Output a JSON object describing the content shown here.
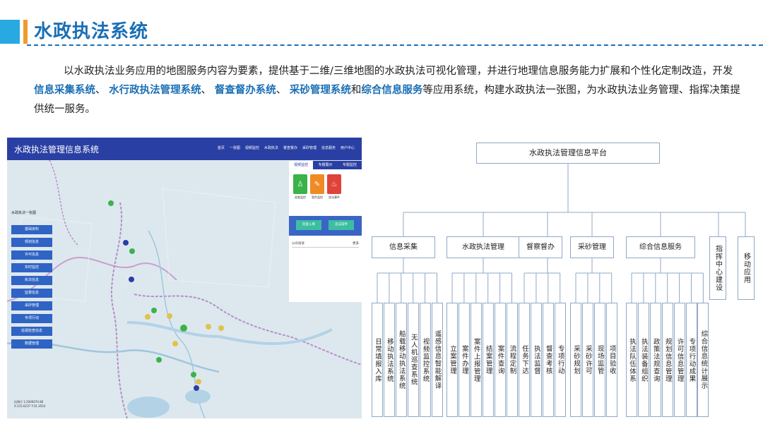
{
  "header": {
    "title": "水政执法系统",
    "accent_blue": "#29a9e1",
    "accent_orange": "#f29a2e",
    "title_color": "#1a6fb5"
  },
  "intro": {
    "p1": "以水政执法业务应用的地图服务内容为要素，提供基于二维/三维地图的水政执法可视化管理，并进行地理信息服务能力扩展和个性化定制改造，开发",
    "h1": "信息采集系统",
    "s1": "、 ",
    "h2": "水行政执法管理系统",
    "s2": "、 ",
    "h3": "督查督办系统",
    "s3": "、 ",
    "h4": "采砂管理系统",
    "s4": "和",
    "h5": "综合信息服务",
    "p2": "等应用系统，构建水政执法一张图，为水政执法业务管理、指挥决策提供统一服务。"
  },
  "screenshot": {
    "title": "水政执法管理信息系统",
    "nav": [
      "首页",
      "一张图",
      "视频监控",
      "水政执法",
      "督查督办",
      "采砂管理",
      "信息服务",
      "用户中心"
    ],
    "side_heading": "水政执法一张图",
    "side_items": [
      "基础资料",
      "规划信息",
      "许可信息",
      "实时监控",
      "执法信息",
      "监督信息",
      "采砂管理",
      "专项行动",
      "巡视检查信息",
      "数据管理"
    ],
    "panel_tabs": [
      "视频监控",
      "专题展示",
      "专题监控"
    ],
    "panel_icons": [
      {
        "label": "巡查监控",
        "icon": "patrol-icon",
        "color": "#3ab34a",
        "glyph": "♙"
      },
      {
        "label": "案件监控",
        "icon": "case-icon",
        "color": "#f08a24",
        "glyph": "✎"
      },
      {
        "label": "违法事件",
        "icon": "alarm-icon",
        "color": "#e0433a",
        "glyph": "♨"
      }
    ],
    "panel_buttons": [
      "巡查入库",
      "违法案件"
    ],
    "notice": "公众投诉",
    "notice_more": "更多",
    "coords_line1": "比例尺 1:2000074.86",
    "coords_line2": "X:115.6237 Y:31.3554"
  },
  "org_chart": {
    "root": "水政执法管理信息平台",
    "groups": [
      {
        "label": "信息采集",
        "children": [
          "日常填报入库",
          "移动执法系统",
          "船载移动执法系统",
          "无人机巡查系统",
          "视频监控系统",
          "遥感信息智能解译"
        ]
      },
      {
        "label": "水政执法管理",
        "children": [
          "立案管理",
          "案件办理",
          "案件上报管理",
          "结案管理",
          "案件查询",
          "流程定制"
        ]
      },
      {
        "label": "督察督办",
        "children": [
          "任务下达",
          "执法监督",
          "督查考核",
          "专项行动"
        ]
      },
      {
        "label": "采砂管理",
        "children": [
          "采砂规划",
          "采砂许可",
          "现场监管",
          "项目验收"
        ]
      },
      {
        "label": "综合信息服务",
        "children": [
          "执法队伍体系",
          "执法装备组织",
          "政策法规查询",
          "规划信息管理",
          "许可信息管理",
          "专项行动成果",
          "综合信息统计展示"
        ]
      }
    ],
    "singles": [
      "指挥中心建设",
      "移动应用"
    ]
  }
}
